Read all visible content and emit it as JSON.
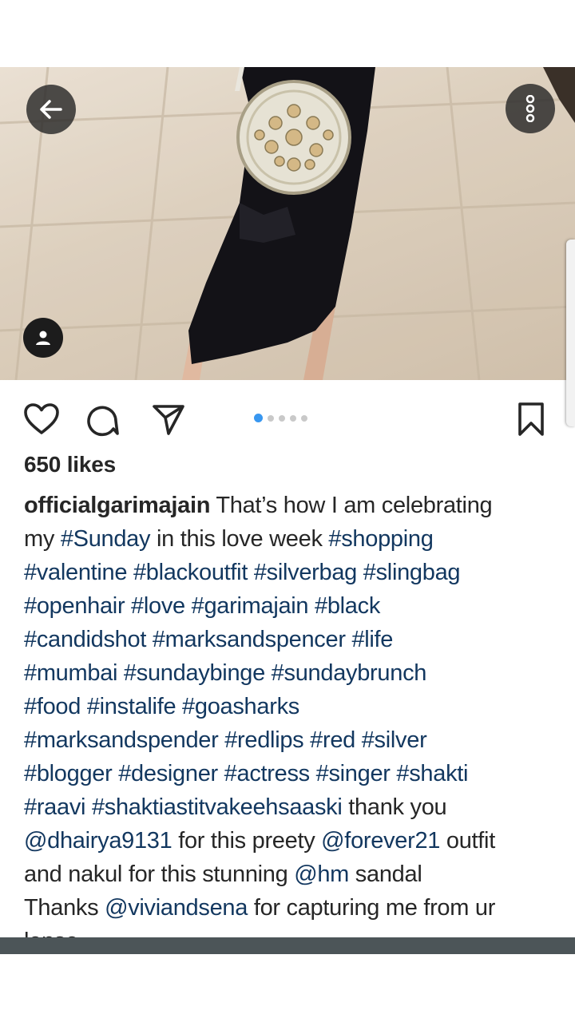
{
  "post": {
    "likes": "650 likes",
    "username": "officialgarimajain",
    "carousel": {
      "count": 5,
      "active_index": 0
    }
  },
  "caption_lines": [
    [
      {
        "t": "officialgarimajain",
        "k": "user"
      },
      {
        "t": " That’s how I am celebrating",
        "k": "text"
      }
    ],
    [
      {
        "t": "my ",
        "k": "text"
      },
      {
        "t": "#Sunday",
        "k": "tag"
      },
      {
        "t": " in this love week ",
        "k": "text"
      },
      {
        "t": "#shopping",
        "k": "tag"
      }
    ],
    [
      {
        "t": "#valentine #blackoutfit #silverbag #slingbag",
        "k": "tag"
      }
    ],
    [
      {
        "t": "#openhair #love #garimajain #black",
        "k": "tag"
      }
    ],
    [
      {
        "t": "#candidshot #marksandspencer #life",
        "k": "tag"
      }
    ],
    [
      {
        "t": "#mumbai #sundaybinge #sundaybrunch",
        "k": "tag"
      }
    ],
    [
      {
        "t": "#food #instalife #goasharks",
        "k": "tag"
      }
    ],
    [
      {
        "t": "#marksandspender #redlips #red #silver",
        "k": "tag"
      }
    ],
    [
      {
        "t": "#blogger #designer #actress #singer #shakti",
        "k": "tag"
      }
    ],
    [
      {
        "t": "#raavi #shaktiastitvakeehsaaski",
        "k": "tag"
      },
      {
        "t": " thank you",
        "k": "text"
      }
    ],
    [
      {
        "t": "@dhairya9131",
        "k": "tag"
      },
      {
        "t": " for this preety ",
        "k": "text"
      },
      {
        "t": "@forever21",
        "k": "tag"
      },
      {
        "t": " outfit",
        "k": "text"
      }
    ],
    [
      {
        "t": "and nakul for this stunning ",
        "k": "text"
      },
      {
        "t": "@hm",
        "k": "tag"
      },
      {
        "t": " sandal",
        "k": "text"
      }
    ],
    [
      {
        "t": "Thanks ",
        "k": "text"
      },
      {
        "t": "@viviandsena",
        "k": "tag"
      },
      {
        "t": " for capturing me from ur",
        "k": "text"
      }
    ],
    [
      {
        "t": "lense",
        "k": "text"
      }
    ]
  ],
  "icons": {
    "back": "arrow-left-icon",
    "more": "more-vertical-icon",
    "user_tag": "user-tag-icon",
    "like": "heart-icon",
    "comment": "comment-icon",
    "share": "send-icon",
    "bookmark": "bookmark-icon"
  },
  "colors": {
    "hashtag": "#12375f",
    "text": "#262626",
    "carousel_active": "#3897f0",
    "carousel_inactive": "#c9c9c9"
  }
}
